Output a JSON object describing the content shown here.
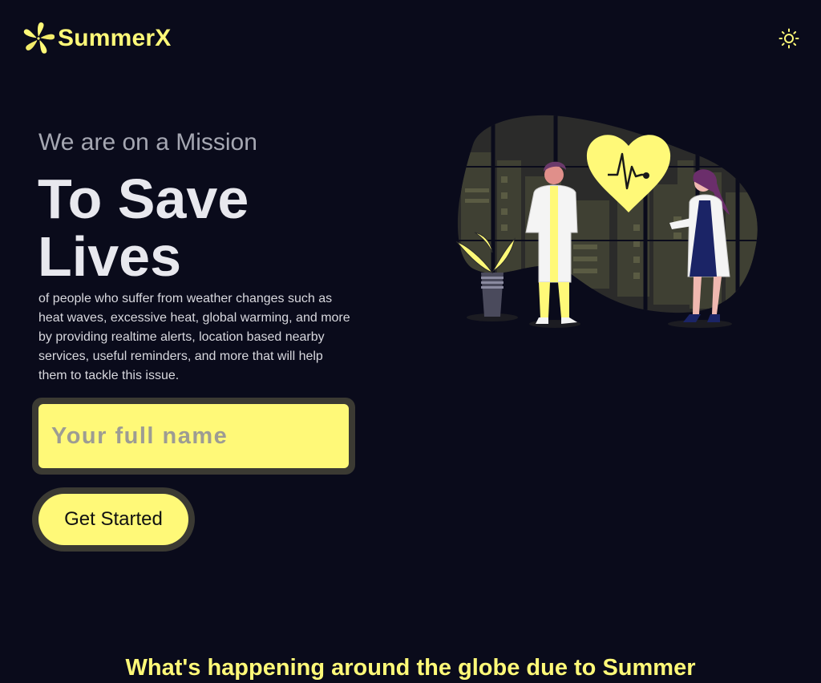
{
  "brand": {
    "name": "SummerX",
    "logo_icon": "flower-icon",
    "accent": "#fff978"
  },
  "header": {
    "theme_toggle_icon": "sun-icon"
  },
  "hero": {
    "eyebrow": "We are on a Mission",
    "headline_line1": "To Save",
    "headline_line2": "Lives",
    "description": "of people who suffer from weather changes such as heat waves, excessive heat, global warming, and more by providing realtime alerts, location based nearby services, useful reminders, and more that will help them to tackle this issue.",
    "name_placeholder": "Your full name",
    "name_value": "",
    "cta_label": "Get Started"
  },
  "illustration": {
    "icon": "doctors-heartbeat-illustration"
  },
  "section": {
    "title": "What's happening around the globe due to Summer"
  },
  "colors": {
    "background": "#0a0b1b",
    "accent": "#fff978",
    "input_border": "#3b3a33"
  }
}
